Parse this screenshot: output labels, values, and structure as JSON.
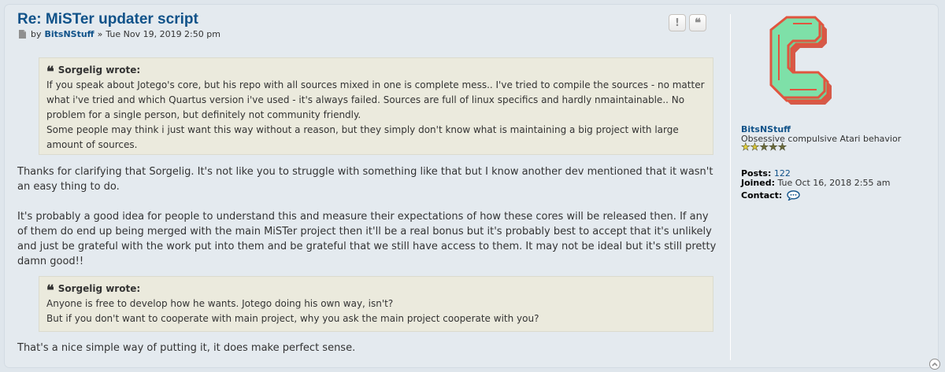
{
  "post": {
    "title": "Re: MiSTer updater script",
    "by_label": "by",
    "author": "BitsNStuff",
    "separator": "»",
    "timestamp": "Tue Nov 19, 2019 2:50 pm",
    "buttons": {
      "report_icon": "!",
      "quote_icon": "❝",
      "report": "report-icon",
      "quote": "quote-icon"
    },
    "quotes": [
      {
        "cite": "Sorgelig wrote:",
        "lines": [
          "If you speak about Jotego's core, but his repo with all sources mixed in one is complete mess.. I've tried to compile the sources - no matter what i've tried and which Quartus version i've used - it's always failed. Sources are full of linux specifics and hardly nmaintainable.. No problem for a single person, but definitely not community friendly.",
          "Some people may think i just want this way without a reason, but they simply don't know what is maintaining a big project with large amount of sources."
        ]
      },
      {
        "cite": "Sorgelig wrote:",
        "lines": [
          "Anyone is free to develop how he wants. Jotego doing his own way, isn't?",
          "But if you don't want to cooperate with main project, why you ask the main project cooperate with you?"
        ]
      }
    ],
    "paragraphs": [
      "Thanks for clarifying that Sorgelig. It's not like you to struggle with something like that but I know another dev mentioned that it wasn't an easy thing to do.",
      "It's probably a good idea for people to understand this and measure their expectations of how these cores will be released then. If any of them do end up being merged with the main MiSTer project then it'll be a real bonus but it's probably best to accept that it's unlikely and just be grateful with the work put into them and be grateful that we still have access to them. It may not be ideal but it's still pretty damn good!!",
      "That's a nice simple way of putting it, it does make perfect sense."
    ]
  },
  "profile": {
    "username": "BitsNStuff",
    "rank_title": "Obsessive compulsive Atari behavior",
    "rank_stars": 5,
    "posts_label": "Posts:",
    "posts_value": "122",
    "joined_label": "Joined:",
    "joined_value": "Tue Oct 16, 2018 2:55 am",
    "contact_label": "Contact:",
    "contact_icon": "speech-bubble-icon",
    "avatar_icon": "stylized-c-logo-icon"
  },
  "colors": {
    "link": "#105289",
    "post_bg": "#e4eaef",
    "quote_bg": "#ebeadd",
    "avatar_fill": "#6fd39a",
    "avatar_stroke": "#e0553f"
  }
}
